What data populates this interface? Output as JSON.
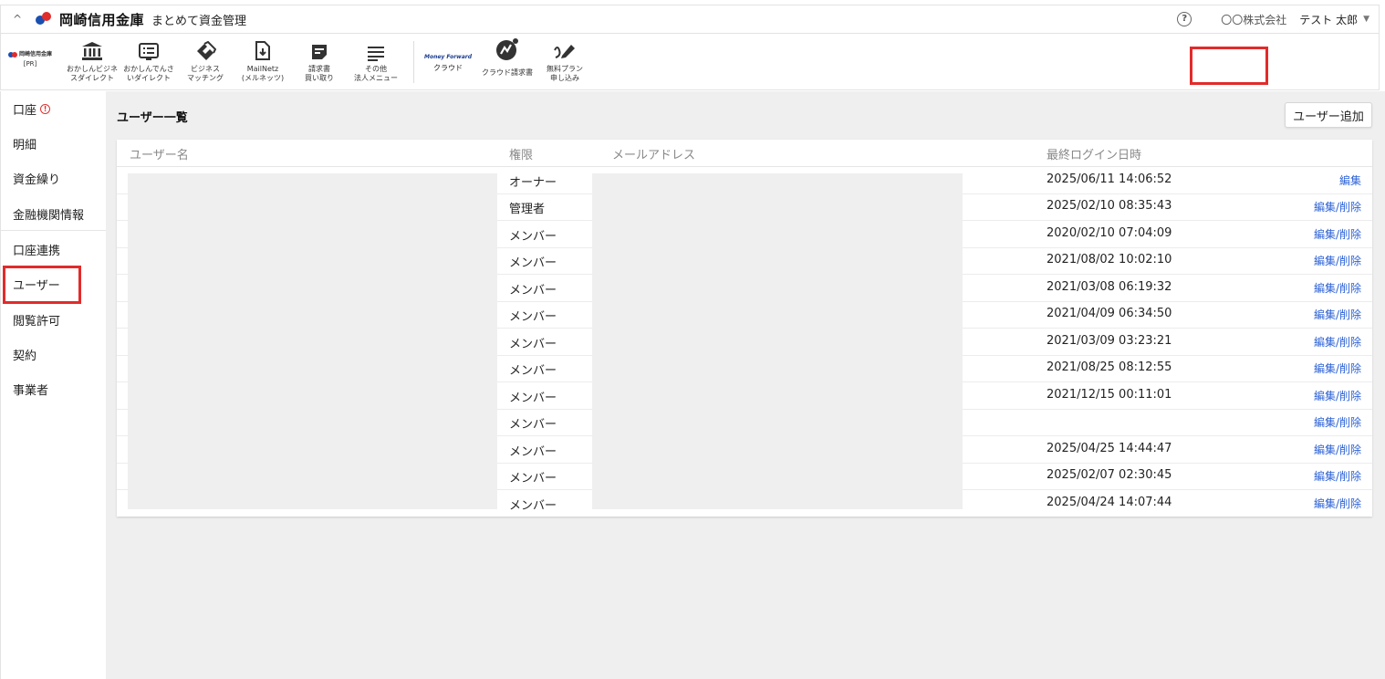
{
  "header": {
    "collapse_glyph": "^",
    "brand": "岡崎信用金庫",
    "app_title": "まとめて資金管理",
    "help_glyph": "?",
    "company": "〇〇株式会社",
    "user": "テスト 太郎",
    "caret": "▼"
  },
  "toolbar": {
    "pr_brand": "岡崎信用金庫",
    "pr_label": "[PR]",
    "items": [
      {
        "line1": "おかしんビジネ",
        "line2": "スダイレクト",
        "icon": "bank-icon"
      },
      {
        "line1": "おかしんでんさ",
        "line2": "いダイレクト",
        "icon": "document-list-icon"
      },
      {
        "line1": "ビジネス",
        "line2": "マッチング",
        "icon": "handshake-icon"
      },
      {
        "line1": "MailNetz",
        "line2": "(メルネッツ)",
        "icon": "mail-download-icon"
      },
      {
        "line1": "請求書",
        "line2": "買い取り",
        "icon": "invoice-icon"
      },
      {
        "line1": "その他",
        "line2": "法人メニュー",
        "icon": "menu-lines-icon"
      }
    ],
    "mf_name": "Money Forward",
    "mf_sub": "クラウド",
    "cloud_invoice": "クラウド請求書",
    "free_plan_line1": "無料プラン",
    "free_plan_line2": "申し込み"
  },
  "sidebar": {
    "items": [
      "口座",
      "明細",
      "資金繰り",
      "金融機関情報",
      "口座連携",
      "ユーザー",
      "閲覧許可",
      "契約",
      "事業者"
    ],
    "warn_glyph": "!"
  },
  "main": {
    "title": "ユーザー一覧",
    "add_button": "ユーザー追加",
    "columns": {
      "name": "ユーザー名",
      "role": "権限",
      "email": "メールアドレス",
      "last_login": "最終ログイン日時"
    },
    "rows": [
      {
        "role": "オーナー",
        "last_login": "2025/06/11 14:06:52",
        "action": "編集"
      },
      {
        "role": "管理者",
        "last_login": "2025/02/10 08:35:43",
        "action": "編集/削除"
      },
      {
        "role": "メンバー",
        "last_login": "2020/02/10 07:04:09",
        "action": "編集/削除"
      },
      {
        "role": "メンバー",
        "last_login": "2021/08/02 10:02:10",
        "action": "編集/削除"
      },
      {
        "role": "メンバー",
        "last_login": "2021/03/08 06:19:32",
        "action": "編集/削除"
      },
      {
        "role": "メンバー",
        "last_login": "2021/04/09 06:34:50",
        "action": "編集/削除"
      },
      {
        "role": "メンバー",
        "last_login": "2021/03/09 03:23:21",
        "action": "編集/削除"
      },
      {
        "role": "メンバー",
        "last_login": "2021/08/25 08:12:55",
        "action": "編集/削除"
      },
      {
        "role": "メンバー",
        "last_login": "2021/12/15 00:11:01",
        "action": "編集/削除"
      },
      {
        "role": "メンバー",
        "last_login": "",
        "action": "編集/削除"
      },
      {
        "role": "メンバー",
        "last_login": "2025/04/25 14:44:47",
        "action": "編集/削除"
      },
      {
        "role": "メンバー",
        "last_login": "2025/02/07 02:30:45",
        "action": "編集/削除"
      },
      {
        "role": "メンバー",
        "last_login": "2025/04/24 14:07:44",
        "action": "編集/削除"
      }
    ]
  },
  "colors": {
    "accent_link": "#2d62d6",
    "highlight": "#e22b2b",
    "brand_blue": "#1a4fb0",
    "brand_red": "#e22b2b"
  }
}
